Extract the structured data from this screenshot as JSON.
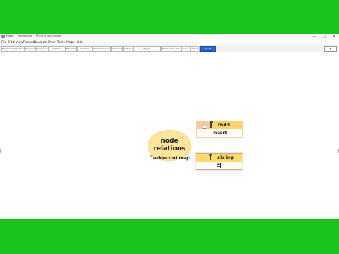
{
  "window": {
    "title": "Map* - Freeplane - Mind map mode",
    "controls": [
      "—",
      "□",
      "✕"
    ]
  },
  "menu": [
    "File",
    "Edit",
    "View",
    "Format",
    "Navigate",
    "Filter",
    "Tools",
    "Maps",
    "Help"
  ],
  "toolbar": {
    "buttons": [
      "Freeplane: Important Features",
      "freeplane_tutorial",
      "Formeln und Wachstum",
      "Gefahren",
      "Mindmaps",
      "Relations",
      "Zusammenfassung",
      "Kommunikation",
      "Prüfungen",
      "Regeln",
      "Relationship map",
      "node - subject of map",
      "Map1"
    ],
    "active_tab": "Map1*",
    "zoom": "▼"
  },
  "map": {
    "root": {
      "line1": "node",
      "line2": "relations",
      "subtitle": "subject of map"
    },
    "child": {
      "label": "child",
      "body": "Insert"
    },
    "sibling": {
      "label": "sibling",
      "body": "E"
    }
  },
  "colors": {
    "green_border": "#1ac41a",
    "node_fill": "#ffe599",
    "node_header": "#ffd96a",
    "active_tab": "#2c63d6"
  }
}
